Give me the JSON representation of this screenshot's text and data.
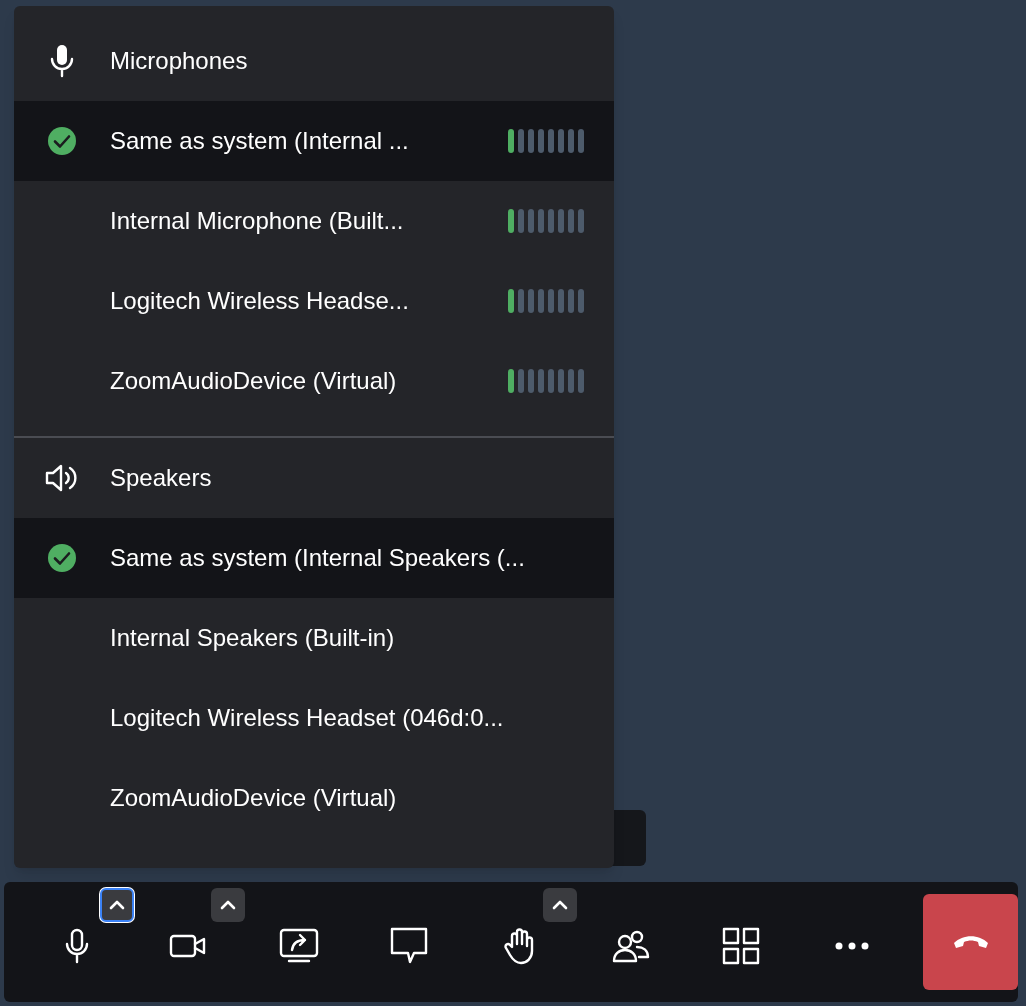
{
  "audio_menu": {
    "sections": [
      {
        "kind": "microphone",
        "title": "Microphones",
        "items": [
          {
            "label": "Same as system (Internal ...",
            "selected": true,
            "level": 0.125
          },
          {
            "label": "Internal Microphone (Built...",
            "selected": false,
            "level": 0.125
          },
          {
            "label": "Logitech Wireless Headse...",
            "selected": false,
            "level": 0.125
          },
          {
            "label": "ZoomAudioDevice (Virtual)",
            "selected": false,
            "level": 0.125
          }
        ]
      },
      {
        "kind": "speaker",
        "title": "Speakers",
        "items": [
          {
            "label": "Same as system (Internal Speakers (...",
            "selected": true
          },
          {
            "label": "Internal Speakers (Built-in)",
            "selected": false
          },
          {
            "label": "Logitech Wireless Headset (046d:0...",
            "selected": false
          },
          {
            "label": "ZoomAudioDevice (Virtual)",
            "selected": false
          }
        ]
      }
    ]
  },
  "toolbar": {
    "buttons": [
      {
        "kind": "mic",
        "chevron": true,
        "chevron_selected": true
      },
      {
        "kind": "camera",
        "chevron": true,
        "chevron_selected": false
      },
      {
        "kind": "share"
      },
      {
        "kind": "chat"
      },
      {
        "kind": "hand",
        "chevron": true,
        "chevron_selected": false
      },
      {
        "kind": "participants"
      },
      {
        "kind": "grid"
      },
      {
        "kind": "more"
      },
      {
        "kind": "hangup"
      }
    ]
  }
}
